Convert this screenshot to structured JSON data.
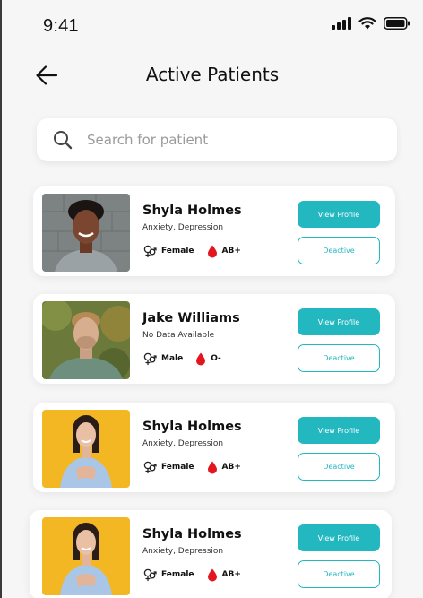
{
  "status_bar": {
    "time": "9:41"
  },
  "header": {
    "title": "Active Patients"
  },
  "search": {
    "placeholder": "Search for patient"
  },
  "buttons": {
    "view_profile": "View Profile",
    "deactive": "Deactive"
  },
  "colors": {
    "accent": "#23b7c0",
    "blood": "#e3161f"
  },
  "patients": [
    {
      "name": "Shyla Holmes",
      "condition": "Anxiety, Depression",
      "gender": "Female",
      "blood_group": "AB+"
    },
    {
      "name": "Jake Williams",
      "condition": "No Data Available",
      "gender": "Male",
      "blood_group": "O-"
    },
    {
      "name": "Shyla Holmes",
      "condition": "Anxiety, Depression",
      "gender": "Female",
      "blood_group": "AB+"
    },
    {
      "name": "Shyla Holmes",
      "condition": "Anxiety, Depression",
      "gender": "Female",
      "blood_group": "AB+"
    }
  ]
}
